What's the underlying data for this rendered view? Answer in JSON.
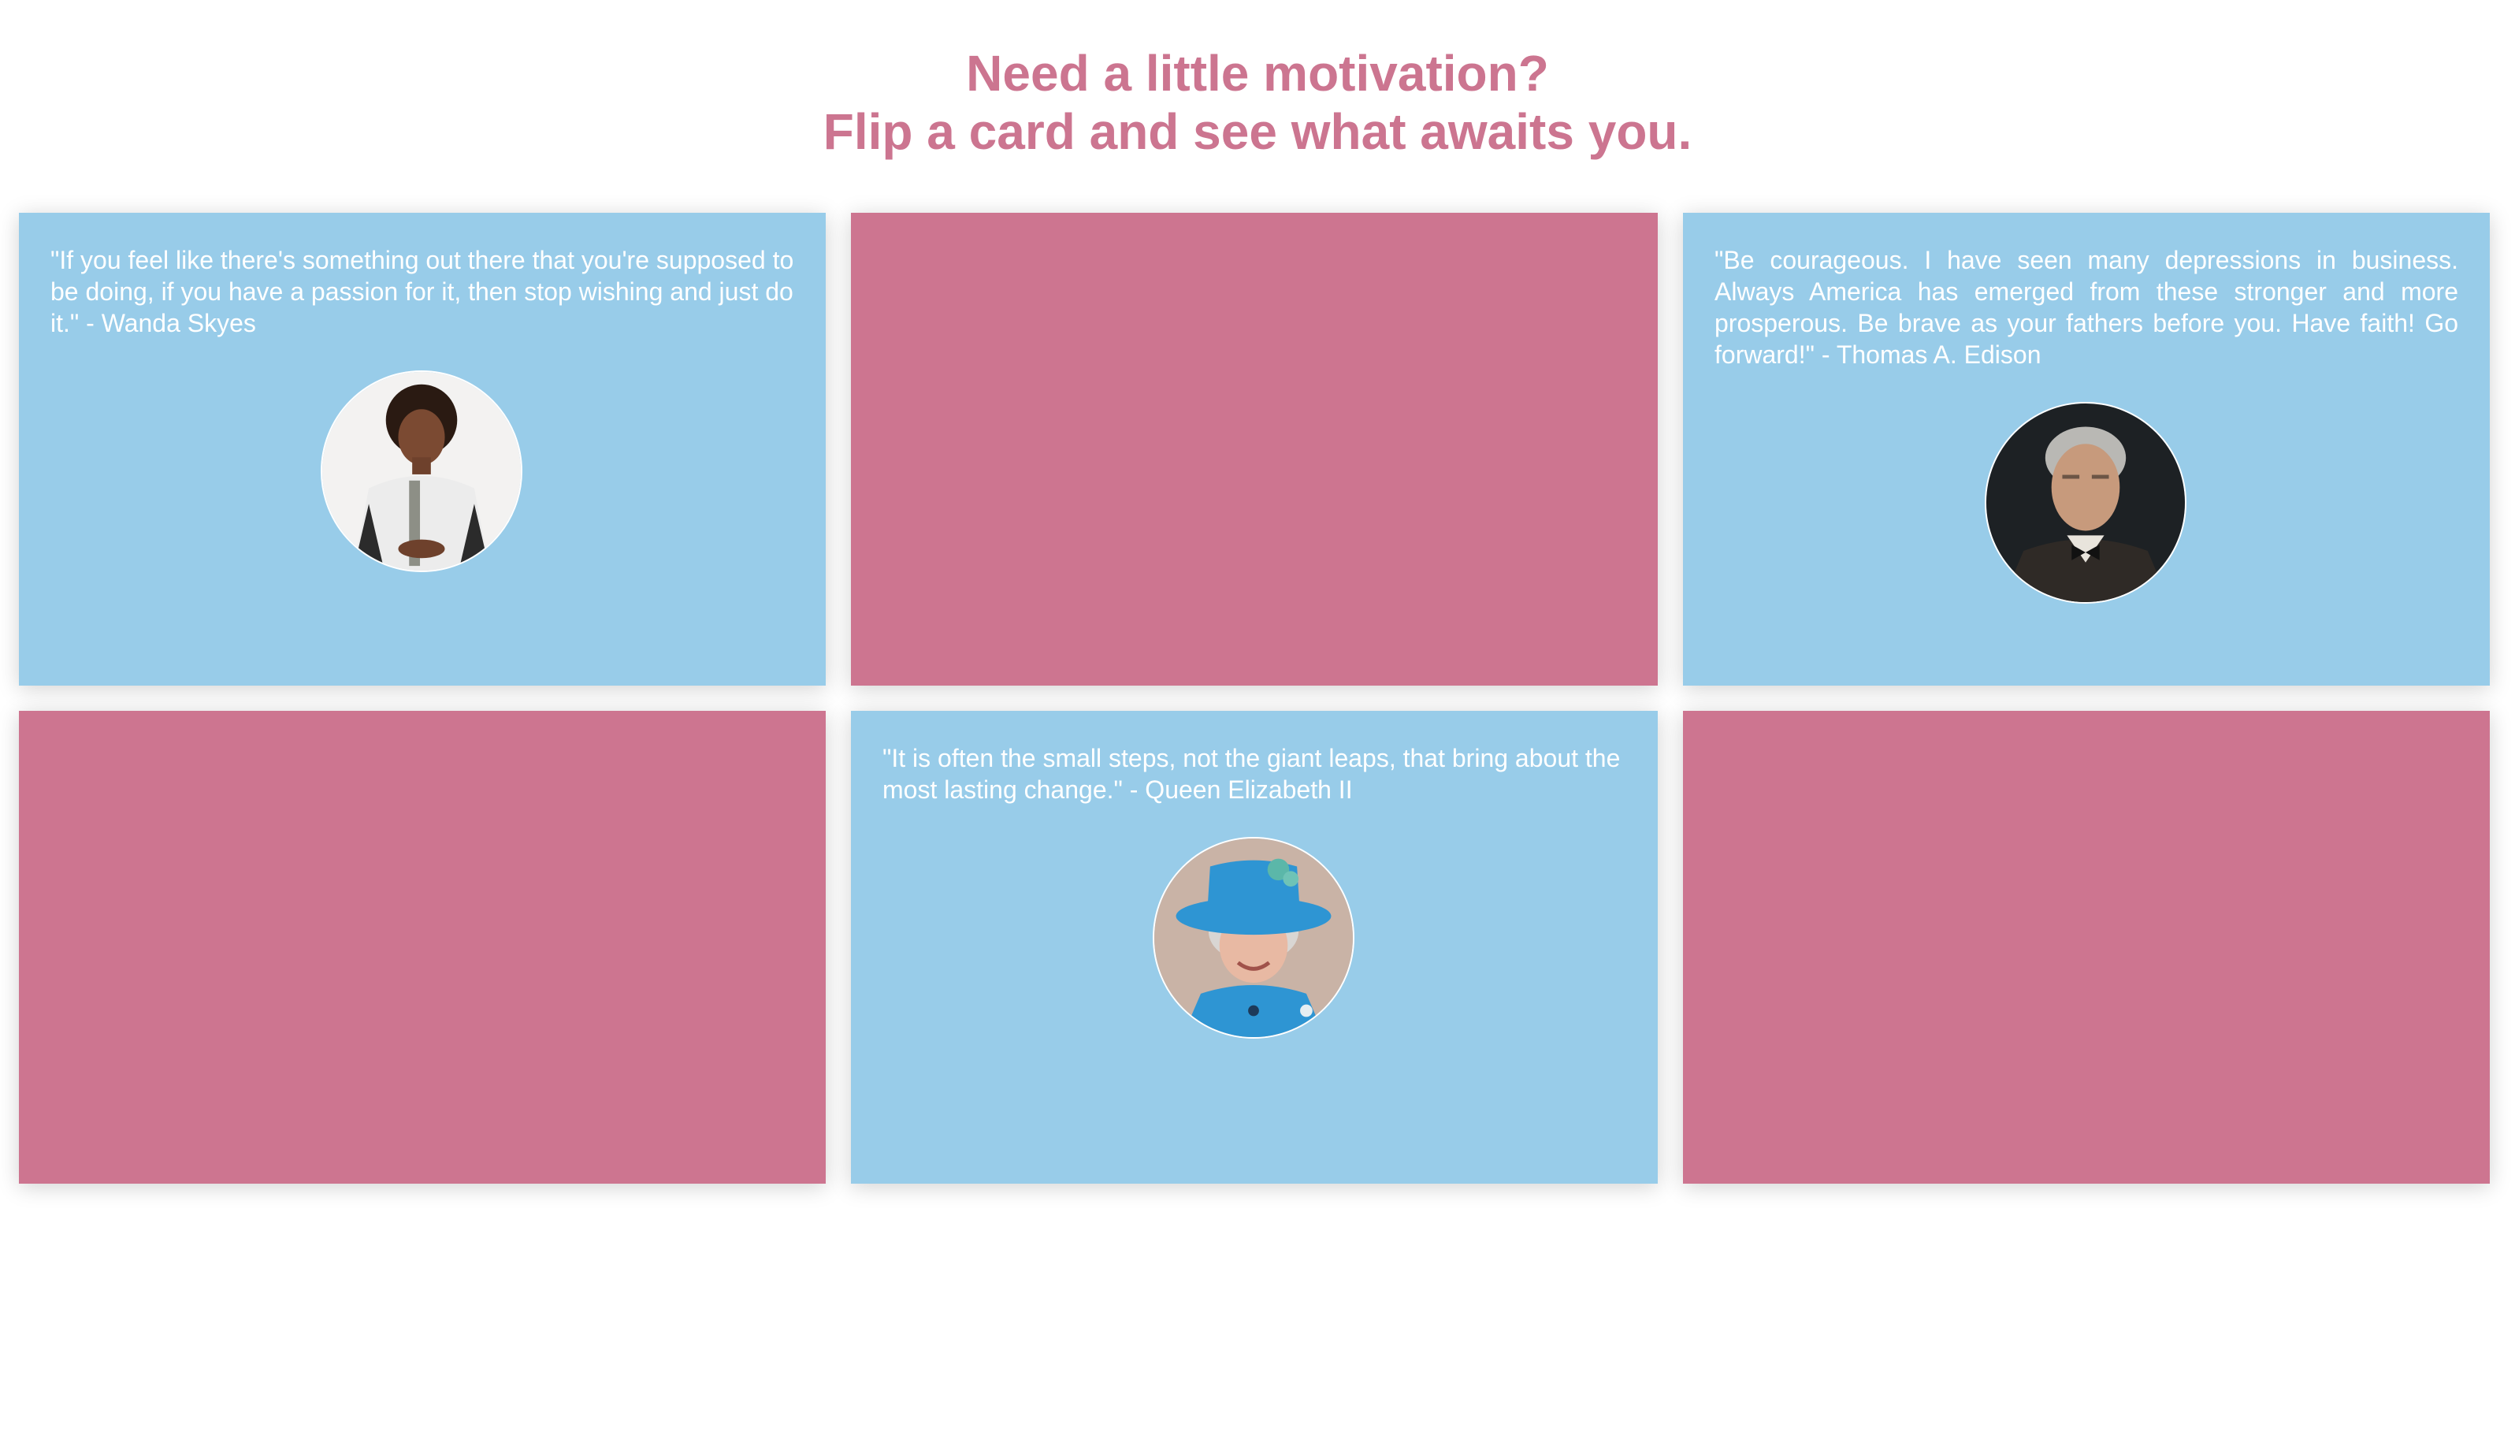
{
  "header": {
    "line1": "Need a little motivation?",
    "line2": "Flip a card and see what awaits you."
  },
  "colors": {
    "accent": "#cc7590",
    "card_front": "#cd7590",
    "card_back": "#98cce9",
    "text_on_card": "#ffffff"
  },
  "cards": [
    {
      "state": "flipped",
      "quote": "\"If you feel like there's something out there that you're supposed to be doing, if you have a passion for it, then stop wishing and just do it.\" - Wanda Skyes",
      "portrait_icon": "wanda-skyes-portrait"
    },
    {
      "state": "face-down"
    },
    {
      "state": "flipped",
      "quote": "\"Be courageous. I have seen many depressions in business. Always America has emerged from these stronger and more prosperous. Be brave as your fathers before you. Have faith! Go forward!\" - Thomas A. Edison",
      "portrait_icon": "thomas-edison-portrait"
    },
    {
      "state": "face-down"
    },
    {
      "state": "flipped",
      "quote": "\"It is often the small steps, not the giant leaps, that bring about the most lasting change.\" - Queen Elizabeth II",
      "portrait_icon": "queen-elizabeth-portrait"
    },
    {
      "state": "face-down"
    }
  ]
}
